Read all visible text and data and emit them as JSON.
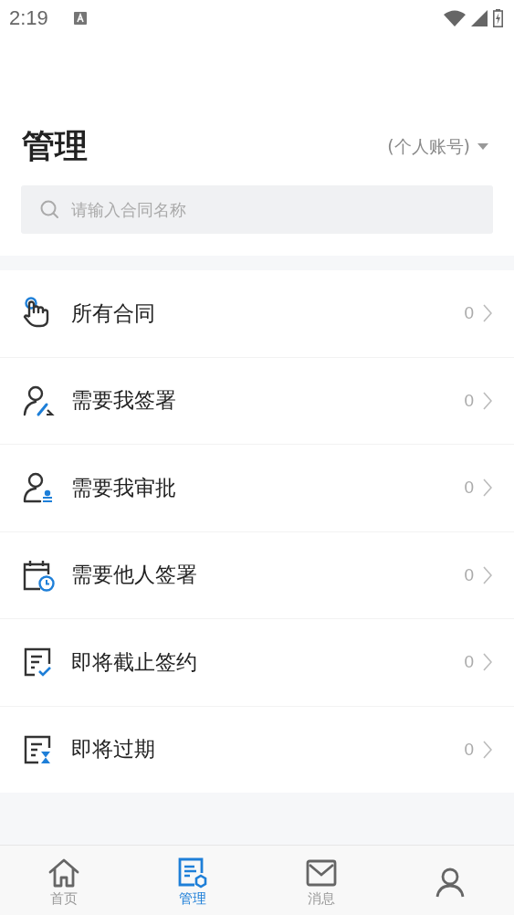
{
  "status_bar": {
    "time": "2:19"
  },
  "header": {
    "title": "管理",
    "account": "(个人账号)"
  },
  "search": {
    "placeholder": "请输入合同名称"
  },
  "items": [
    {
      "kind": "hand",
      "label": "所有合同",
      "count": "0"
    },
    {
      "kind": "sign",
      "label": "需要我签署",
      "count": "0"
    },
    {
      "kind": "approve",
      "label": "需要我审批",
      "count": "0"
    },
    {
      "kind": "calendar",
      "label": "需要他人签署",
      "count": "0"
    },
    {
      "kind": "deadline",
      "label": "即将截止签约",
      "count": "0"
    },
    {
      "kind": "expire",
      "label": "即将过期",
      "count": "0"
    }
  ],
  "tabs": [
    {
      "kind": "home",
      "label": "首页",
      "selected": false
    },
    {
      "kind": "manage",
      "label": "管理",
      "selected": true
    },
    {
      "kind": "message",
      "label": "消息",
      "selected": false
    },
    {
      "kind": "profile",
      "selected": false
    }
  ]
}
